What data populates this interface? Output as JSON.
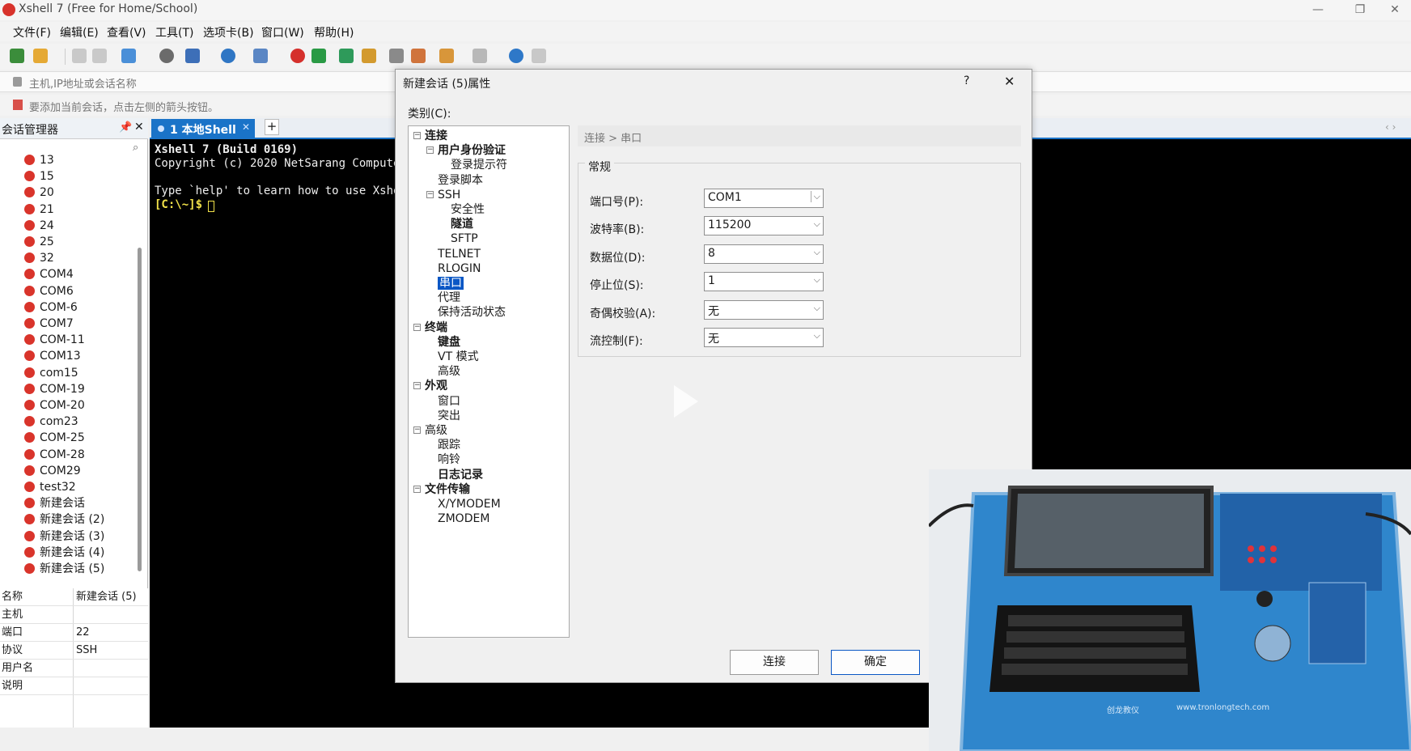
{
  "window": {
    "title": "Xshell 7 (Free for Home/School)"
  },
  "menu": [
    "文件(F)",
    "编辑(E)",
    "查看(V)",
    "工具(T)",
    "选项卡(B)",
    "窗口(W)",
    "帮助(H)"
  ],
  "address_placeholder": "主机,IP地址或会话名称",
  "hint": "要添加当前会话，点击左侧的箭头按钮。",
  "session_manager": {
    "title": "会话管理器",
    "items": [
      "13",
      "15",
      "20",
      "21",
      "24",
      "25",
      "32",
      "COM4",
      "COM6",
      "COM-6",
      "COM7",
      "COM-11",
      "COM13",
      "com15",
      "COM-19",
      "COM-20",
      "com23",
      "COM-25",
      "COM-28",
      "COM29",
      "test32",
      "新建会话",
      "新建会话 (2)",
      "新建会话 (3)",
      "新建会话 (4)",
      "新建会话 (5)"
    ],
    "properties": [
      {
        "key": "名称",
        "value": "新建会话 (5)"
      },
      {
        "key": "主机",
        "value": ""
      },
      {
        "key": "端口",
        "value": "22"
      },
      {
        "key": "协议",
        "value": "SSH"
      },
      {
        "key": "用户名",
        "value": ""
      },
      {
        "key": "说明",
        "value": ""
      }
    ]
  },
  "tab": {
    "label": "1 本地Shell"
  },
  "terminal": {
    "lines": [
      "Xshell 7 (Build 0169)",
      "Copyright (c) 2020 NetSarang Compute",
      "",
      "Type `help' to learn how to use Xshe",
      "[C:\\~]$ "
    ]
  },
  "dialog": {
    "title": "新建会话 (5)属性",
    "help": "?",
    "close": "✕",
    "category_label": "类别(C):",
    "tree": [
      {
        "label": "连接",
        "level": 0,
        "bold": true,
        "expander": "⊟"
      },
      {
        "label": "用户身份验证",
        "level": 1,
        "bold": true,
        "expander": "⊟"
      },
      {
        "label": "登录提示符",
        "level": 2,
        "bold": false
      },
      {
        "label": "登录脚本",
        "level": 1,
        "bold": false
      },
      {
        "label": "SSH",
        "level": 1,
        "bold": false,
        "expander": "⊟"
      },
      {
        "label": "安全性",
        "level": 2,
        "bold": false
      },
      {
        "label": "隧道",
        "level": 2,
        "bold": true
      },
      {
        "label": "SFTP",
        "level": 2,
        "bold": false
      },
      {
        "label": "TELNET",
        "level": 1,
        "bold": false
      },
      {
        "label": "RLOGIN",
        "level": 1,
        "bold": false
      },
      {
        "label": "串口",
        "level": 1,
        "bold": false,
        "selected": true
      },
      {
        "label": "代理",
        "level": 1,
        "bold": false
      },
      {
        "label": "保持活动状态",
        "level": 1,
        "bold": false
      },
      {
        "label": "终端",
        "level": 0,
        "bold": true,
        "expander": "⊟"
      },
      {
        "label": "键盘",
        "level": 1,
        "bold": true
      },
      {
        "label": "VT 模式",
        "level": 1,
        "bold": false
      },
      {
        "label": "高级",
        "level": 1,
        "bold": false
      },
      {
        "label": "外观",
        "level": 0,
        "bold": true,
        "expander": "⊟"
      },
      {
        "label": "窗口",
        "level": 1,
        "bold": false
      },
      {
        "label": "突出",
        "level": 1,
        "bold": false
      },
      {
        "label": "高级",
        "level": 0,
        "bold": false,
        "expander": "⊟"
      },
      {
        "label": "跟踪",
        "level": 1,
        "bold": false
      },
      {
        "label": "响铃",
        "level": 1,
        "bold": false
      },
      {
        "label": "日志记录",
        "level": 1,
        "bold": true
      },
      {
        "label": "文件传输",
        "level": 0,
        "bold": true,
        "expander": "⊟"
      },
      {
        "label": "X/YMODEM",
        "level": 1,
        "bold": false
      },
      {
        "label": "ZMODEM",
        "level": 1,
        "bold": false
      }
    ],
    "breadcrumb": "连接 > 串口",
    "group_title": "常规",
    "fields": [
      {
        "label": "端口号(P):",
        "value": "COM1"
      },
      {
        "label": "波特率(B):",
        "value": "115200"
      },
      {
        "label": "数据位(D):",
        "value": "8"
      },
      {
        "label": "停止位(S):",
        "value": "1"
      },
      {
        "label": "奇偶校验(A):",
        "value": "无"
      },
      {
        "label": "流控制(F):",
        "value": "无"
      }
    ],
    "connect_button": "连接",
    "ok_button": "确定"
  },
  "video_overlay": {
    "url_text": "www.tronlongtech.com",
    "brand_text": "创龙教仪"
  }
}
